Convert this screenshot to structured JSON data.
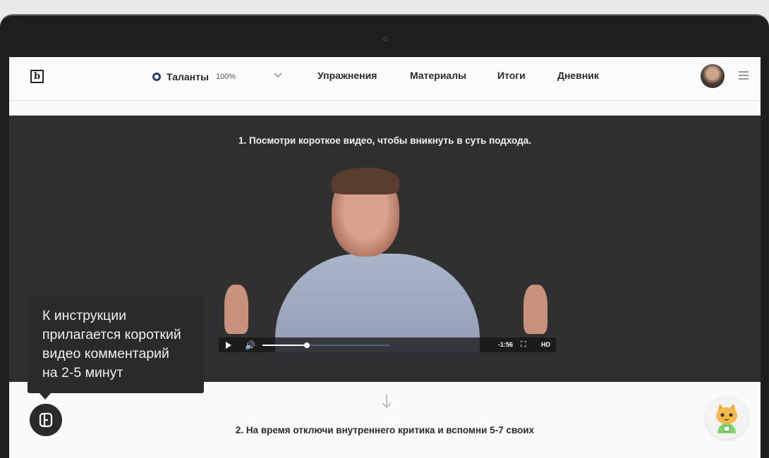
{
  "header": {
    "logo": "b",
    "talents": {
      "label": "Таланты",
      "percent": "100%"
    },
    "nav": [
      {
        "label": "Упражнения"
      },
      {
        "label": "Материалы"
      },
      {
        "label": "Итоги"
      },
      {
        "label": "Дневник"
      }
    ]
  },
  "content": {
    "step1": "1. Посмотри короткое видео, чтобы вникнуть в суть подхода.",
    "step2": "2. На время отключи внутреннего критика и вспомни 5-7 своих"
  },
  "video": {
    "time_remaining": "-1:56",
    "quality": "HD",
    "progress": 0.35,
    "buffered": 1.0
  },
  "tooltip": {
    "lines": [
      "К инструкции",
      "прилагается короткий",
      "видео комментарий",
      "на 2-5 минут"
    ]
  },
  "icons": {
    "logo": "logo-icon",
    "chevron": "chevron-down-icon",
    "menu": "hamburger-menu-icon",
    "play": "play-icon",
    "volume": "volume-icon",
    "fullscreen": "fullscreen-icon",
    "arrow": "arrow-down-icon",
    "help": "brand-logo-icon",
    "assistant": "cat-mascot-icon"
  },
  "colors": {
    "dark_bg": "#2f2f31",
    "accent": "#2c3e74",
    "tooltip_bg": "#2a2a2b"
  }
}
